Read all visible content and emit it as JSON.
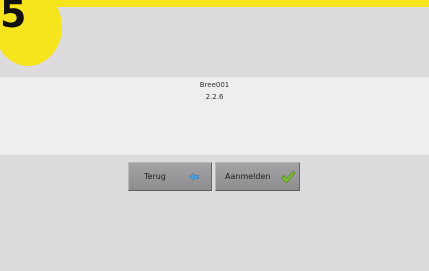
{
  "step": {
    "number": "5"
  },
  "device": {
    "name": "Bree001",
    "version": "2.2.6"
  },
  "buttons": {
    "back_label": "Terug",
    "login_label": "Aanmelden"
  },
  "icons": {
    "back": "back-arrow-icon",
    "login": "checkmark-icon"
  },
  "colors": {
    "accent": "#f6e51c",
    "background": "#dddbde",
    "panel": "#efeeef",
    "back_icon": "#4f9fd8",
    "login_icon": "#7dbb3a"
  }
}
